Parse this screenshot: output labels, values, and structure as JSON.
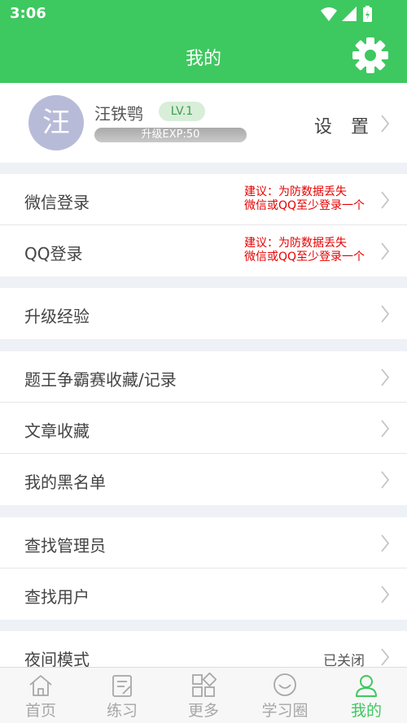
{
  "status_bar": {
    "time": "3:06"
  },
  "header": {
    "title": "我的"
  },
  "profile": {
    "avatar_text": "汪",
    "name": "汪铁鹗",
    "level": "LV.1",
    "exp_label": "升级EXP:50",
    "settings_label": "设 置"
  },
  "login": {
    "wechat": {
      "label": "微信登录",
      "note_line1": "建议：为防数据丢失",
      "note_line2": "微信或QQ至少登录一个"
    },
    "qq": {
      "label": "QQ登录",
      "note_line1": "建议：为防数据丢失",
      "note_line2": "微信或QQ至少登录一个"
    }
  },
  "menu": {
    "upgrade_exp": "升级经验",
    "quiz_records": "题王争霸赛收藏/记录",
    "article_favorites": "文章收藏",
    "blacklist": "我的黑名单",
    "find_admin": "查找管理员",
    "find_user": "查找用户",
    "night_mode": "夜间模式",
    "night_mode_value": "已关闭"
  },
  "tabs": {
    "home": "首页",
    "practice": "练习",
    "more": "更多",
    "circle": "学习圈",
    "mine": "我的"
  },
  "colors": {
    "brand_green": "#3ec860",
    "warning_red": "#e60000"
  }
}
